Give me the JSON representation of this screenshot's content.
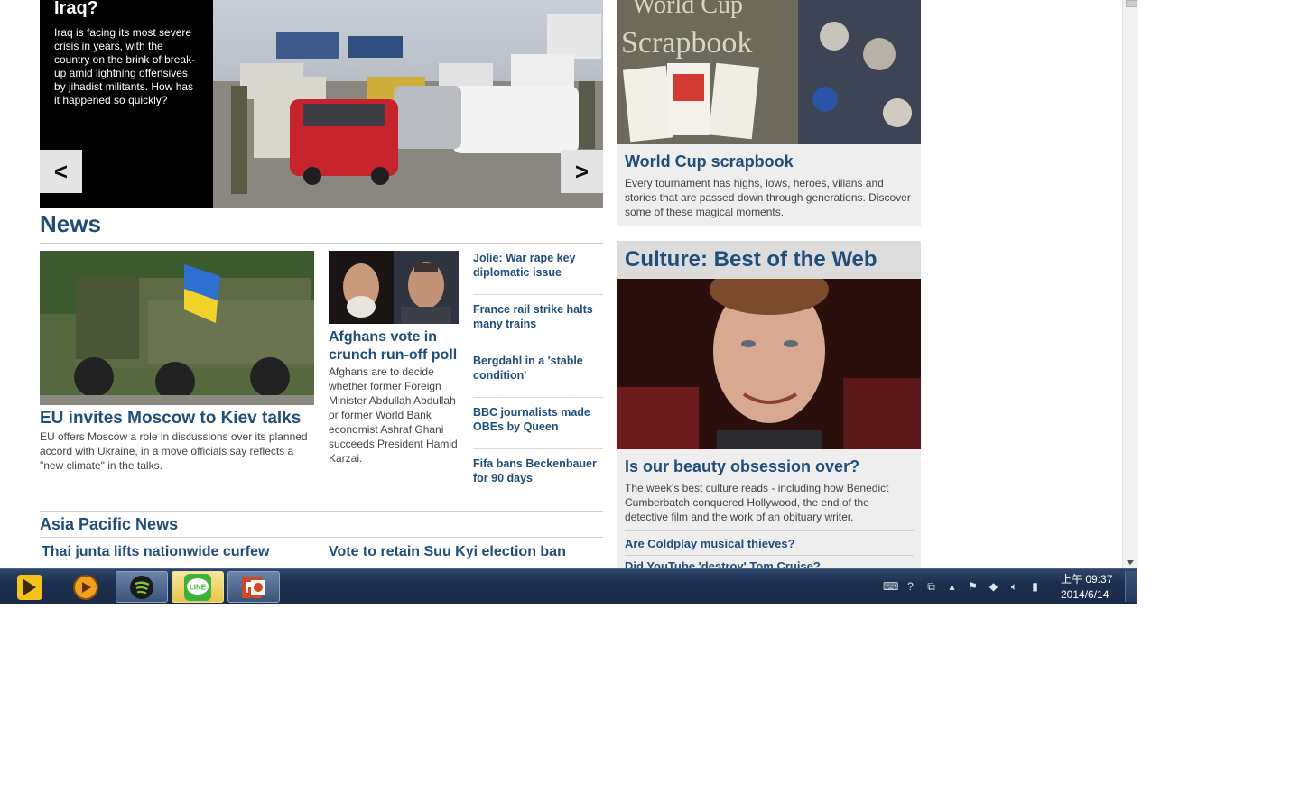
{
  "hero": {
    "title": "Iraq?",
    "description": "Iraq is facing its most severe crisis in years, with the country on the brink of break-up amid lightning offensives by jihadist militants. How has it happened so quickly?",
    "prev_label": "<",
    "next_label": ">"
  },
  "news": {
    "section_title": "News",
    "lead": {
      "headline": "EU invites Moscow to Kiev talks",
      "summary": "EU offers Moscow a role in discussions over its planned accord with Ukraine, in a move officials say reflects a \"new climate\" in the talks."
    },
    "secondary": {
      "headline": "Afghans vote in crunch run-off poll",
      "summary": "Afghans are to decide whether former Foreign Minister Abdullah Abdullah or former World Bank economist Ashraf Ghani succeeds President Hamid Karzai."
    },
    "headlines": [
      "Jolie: War rape key diplomatic issue",
      "France rail strike halts many trains",
      "Bergdahl in a 'stable condition'",
      "BBC journalists made OBEs by Queen",
      "Fifa bans Beckenbauer for 90 days"
    ]
  },
  "asia": {
    "section_title": "Asia Pacific News",
    "links": [
      "Thai junta lifts nationwide curfew",
      "Vote to retain Suu Kyi election ban"
    ]
  },
  "world_cup": {
    "image_text_line1": "World Cup",
    "image_text_line2": "Scrapbook",
    "headline": "World Cup scrapbook",
    "summary": "Every tournament has highs, lows, heroes, villans and stories that are passed down through generations. Discover some of these magical moments."
  },
  "culture": {
    "section_title": "Culture: Best of the Web",
    "headline": "Is our beauty obsession over?",
    "summary": "The week's best culture reads - including how Benedict Cumberbatch conquered Hollywood, the end of the detective film and the work of an obituary writer.",
    "links": [
      "Are Coldplay musical thieves?",
      "Did YouTube 'destroy' Tom Cruise?"
    ]
  },
  "taskbar": {
    "apps": [
      "kakaotalk-icon",
      "media-player-icon",
      "spotify-icon",
      "line-icon",
      "powerpoint-icon"
    ],
    "line_label": "LINE",
    "clock_time": "上午 09:37",
    "clock_date": "2014/6/14"
  },
  "colors": {
    "link_blue": "#1f4e79",
    "panel_grey": "#eeeeee",
    "taskbar_blue": "#1d2f4f"
  }
}
